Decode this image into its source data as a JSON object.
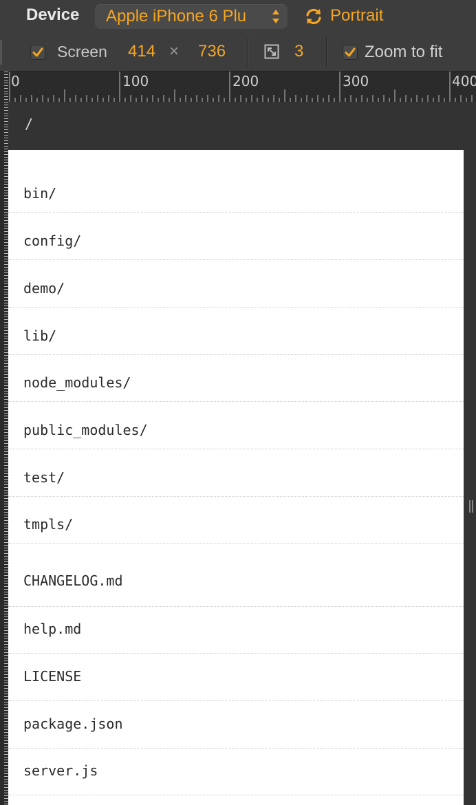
{
  "toolbar": {
    "device_label": "Device",
    "device_value": "Apple iPhone 6 Plu",
    "orientation_label": "Portrait",
    "screen_label": "Screen",
    "screen_width": "414",
    "screen_times": "×",
    "screen_height": "736",
    "device_pixel_ratio": "3",
    "zoom_label": "Zoom to fit",
    "screen_checked": true,
    "zoom_checked": true
  },
  "ruler": {
    "labels": [
      "0",
      "100",
      "200",
      "300",
      "400"
    ]
  },
  "path": "/",
  "files": [
    "bin/",
    "config/",
    "demo/",
    "lib/",
    "node_modules/",
    "public_modules/",
    "test/",
    "tmpls/",
    "CHANGELOG.md",
    "help.md",
    "LICENSE",
    "package.json",
    "server.js"
  ],
  "colors": {
    "accent": "#f5a623",
    "toolbar_bg": "#3d3d3d",
    "content_bg": "#ffffff"
  }
}
